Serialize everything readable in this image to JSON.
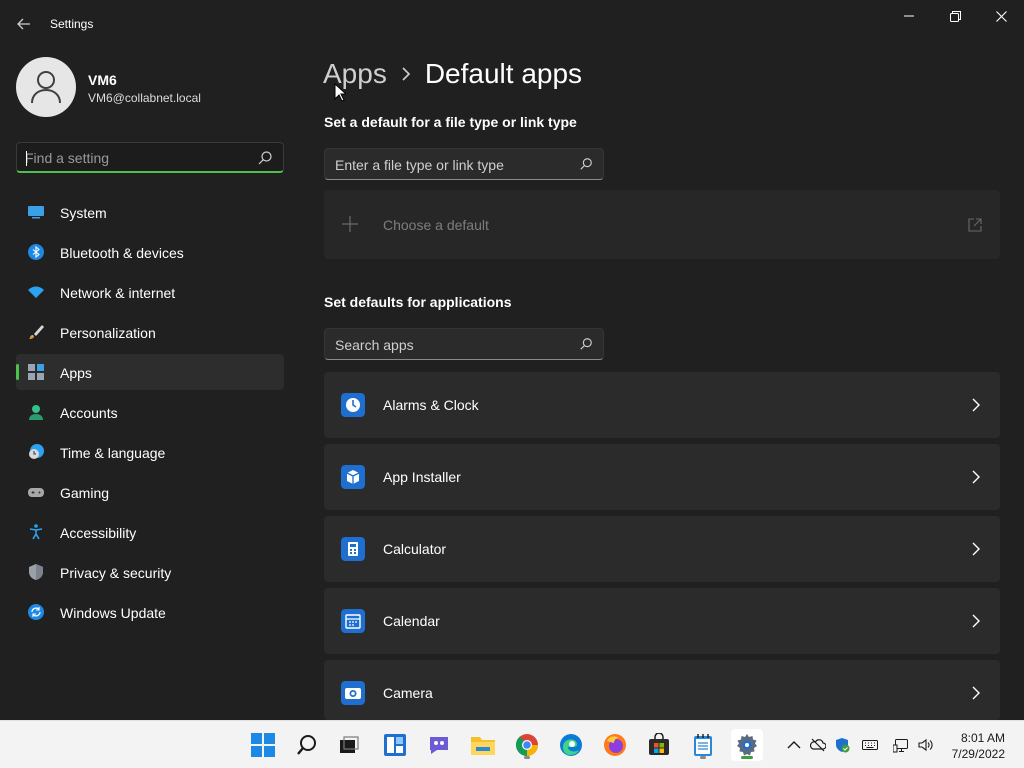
{
  "window": {
    "title": "Settings",
    "back_icon": "back-arrow-icon",
    "controls": [
      "minimize-icon",
      "restore-icon",
      "close-icon"
    ]
  },
  "profile": {
    "name": "VM6",
    "email": "VM6@collabnet.local",
    "avatar_icon": "person-icon"
  },
  "find_setting": {
    "placeholder": "Find a setting"
  },
  "sidebar": {
    "items": [
      {
        "label": "System",
        "icon": "system-icon"
      },
      {
        "label": "Bluetooth & devices",
        "icon": "bluetooth-icon"
      },
      {
        "label": "Network & internet",
        "icon": "wifi-icon"
      },
      {
        "label": "Personalization",
        "icon": "brush-icon"
      },
      {
        "label": "Apps",
        "icon": "apps-icon",
        "selected": true
      },
      {
        "label": "Accounts",
        "icon": "accounts-icon"
      },
      {
        "label": "Time & language",
        "icon": "time-language-icon"
      },
      {
        "label": "Gaming",
        "icon": "gamepad-icon"
      },
      {
        "label": "Accessibility",
        "icon": "accessibility-icon"
      },
      {
        "label": "Privacy & security",
        "icon": "shield-icon"
      },
      {
        "label": "Windows Update",
        "icon": "update-icon"
      }
    ]
  },
  "breadcrumb": {
    "parent": "Apps",
    "current": "Default apps"
  },
  "file_type_section": {
    "title": "Set a default for a file type or link type",
    "search_placeholder": "Enter a file type or link type",
    "choose_default": "Choose a default"
  },
  "apps_section": {
    "title": "Set defaults for applications",
    "search_placeholder": "Search apps",
    "apps": [
      {
        "name": "Alarms & Clock",
        "icon": "alarms-clock-icon"
      },
      {
        "name": "App Installer",
        "icon": "app-installer-icon"
      },
      {
        "name": "Calculator",
        "icon": "calculator-icon"
      },
      {
        "name": "Calendar",
        "icon": "calendar-icon"
      },
      {
        "name": "Camera",
        "icon": "camera-icon"
      }
    ]
  },
  "taskbar": {
    "apps": [
      "windows-start-icon",
      "search-icon",
      "task-view-icon",
      "widgets-icon",
      "chat-icon",
      "file-explorer-icon",
      "chrome-icon",
      "edge-icon",
      "firefox-icon",
      "store-icon",
      "notepad-icon",
      "settings-icon"
    ],
    "tray": [
      "chevron-up-icon",
      "onedrive-icon",
      "security-icon",
      "keyboard-icon",
      "network-icon",
      "volume-icon"
    ],
    "time": "8:01 AM",
    "date": "7/29/2022"
  },
  "colors": {
    "accent": "#4cc24c",
    "background": "#202020",
    "card": "#2b2b2b"
  }
}
